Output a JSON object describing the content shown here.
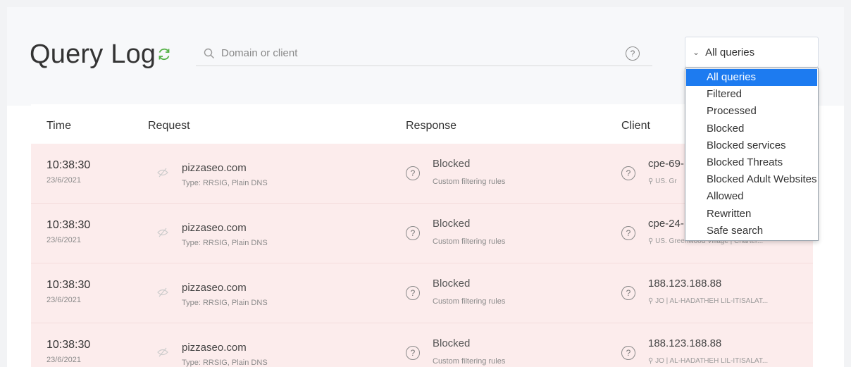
{
  "header": {
    "title": "Query Log",
    "search_placeholder": "Domain or client",
    "filter_selected": "All queries"
  },
  "filter_options": [
    "All queries",
    "Filtered",
    "Processed",
    "Blocked",
    "Blocked services",
    "Blocked Threats",
    "Blocked Adult Websites",
    "Allowed",
    "Rewritten",
    "Safe search"
  ],
  "table": {
    "columns": [
      "Time",
      "Request",
      "Response",
      "Client"
    ],
    "rows": [
      {
        "time": "10:38:30",
        "date": "23/6/2021",
        "domain": "pizzaseo.com",
        "type": "Type: RRSIG, Plain DNS",
        "status": "Blocked",
        "rule": "Custom filtering rules",
        "client": "cpe-69-",
        "client_info": "US. Gr"
      },
      {
        "time": "10:38:30",
        "date": "23/6/2021",
        "domain": "pizzaseo.com",
        "type": "Type: RRSIG, Plain DNS",
        "status": "Blocked",
        "rule": "Custom filtering rules",
        "client": "cpe-24-",
        "client_info": "US. Greenwood Village | Charter..."
      },
      {
        "time": "10:38:30",
        "date": "23/6/2021",
        "domain": "pizzaseo.com",
        "type": "Type: RRSIG, Plain DNS",
        "status": "Blocked",
        "rule": "Custom filtering rules",
        "client": "188.123.188.88",
        "client_info": "JO | AL-HADATHEH LIL-ITISALAT..."
      },
      {
        "time": "10:38:30",
        "date": "23/6/2021",
        "domain": "pizzaseo.com",
        "type": "Type: RRSIG, Plain DNS",
        "status": "Blocked",
        "rule": "Custom filtering rules",
        "client": "188.123.188.88",
        "client_info": "JO | AL-HADATHEH LIL-ITISALAT..."
      }
    ]
  },
  "colors": {
    "accent": "#1d7bf0",
    "refresh": "#52b043",
    "blocked_row": "#fcecec"
  },
  "icons": {
    "refresh": "refresh-icon",
    "search": "search-icon",
    "help": "help-icon",
    "chevron": "chevron-down-icon",
    "eye": "eye-off-icon",
    "location": "location-icon"
  }
}
